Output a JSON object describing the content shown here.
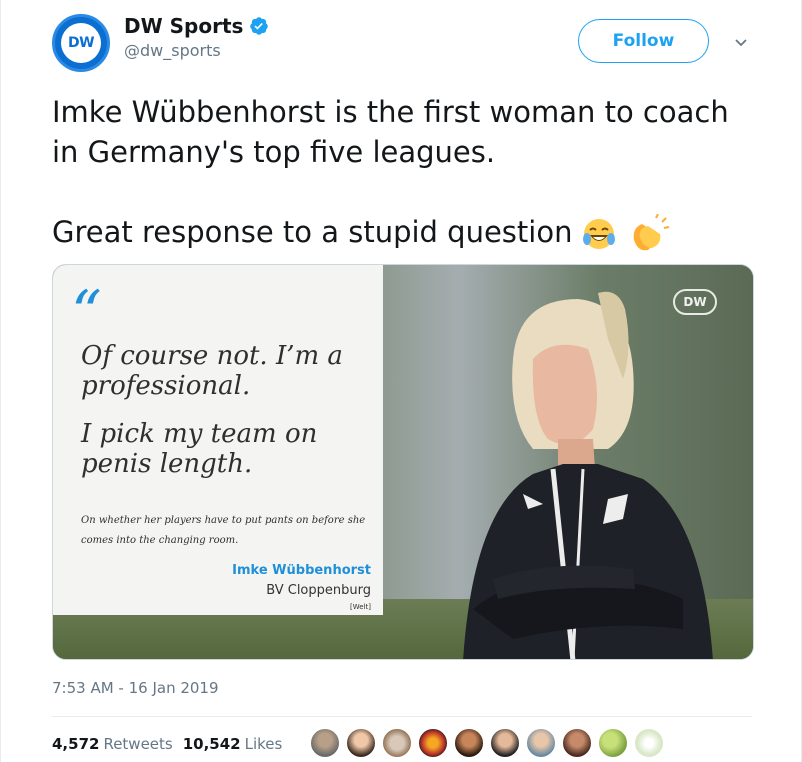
{
  "author": {
    "display_name": "DW Sports",
    "handle": "@dw_sports",
    "avatar_text": "DW",
    "verified": true
  },
  "follow_button": {
    "label": "Follow"
  },
  "tweet": {
    "line1": "Imke Wübbenhorst is the first woman to coach in Germany's top five leagues.",
    "line2": "Great response to a stupid question"
  },
  "media": {
    "quote_mark": "“",
    "quote_part1": "Of course not. I’m a professional.",
    "quote_part2": "I pick my team on penis length.",
    "context": "On whether her players have to put pants on before she comes into the changing room.",
    "name": "Imke Wübbenhorst",
    "club": "BV Cloppenburg",
    "source": "[Welt]",
    "watermark": "DW"
  },
  "timestamp": "7:53 AM - 16 Jan 2019",
  "stats": {
    "retweets_count": "4,572",
    "retweets_label": "Retweets",
    "likes_count": "10,542",
    "likes_label": "Likes"
  },
  "colors": {
    "accent": "#1da1f2",
    "dw_blue": "#0a6fd0",
    "text_secondary": "#657786"
  },
  "likers": [
    {
      "icon": "avatar-1"
    },
    {
      "icon": "avatar-2"
    },
    {
      "icon": "avatar-3"
    },
    {
      "icon": "avatar-4"
    },
    {
      "icon": "avatar-5"
    },
    {
      "icon": "avatar-6"
    },
    {
      "icon": "avatar-7"
    },
    {
      "icon": "avatar-8"
    },
    {
      "icon": "avatar-9"
    },
    {
      "icon": "avatar-10"
    }
  ]
}
